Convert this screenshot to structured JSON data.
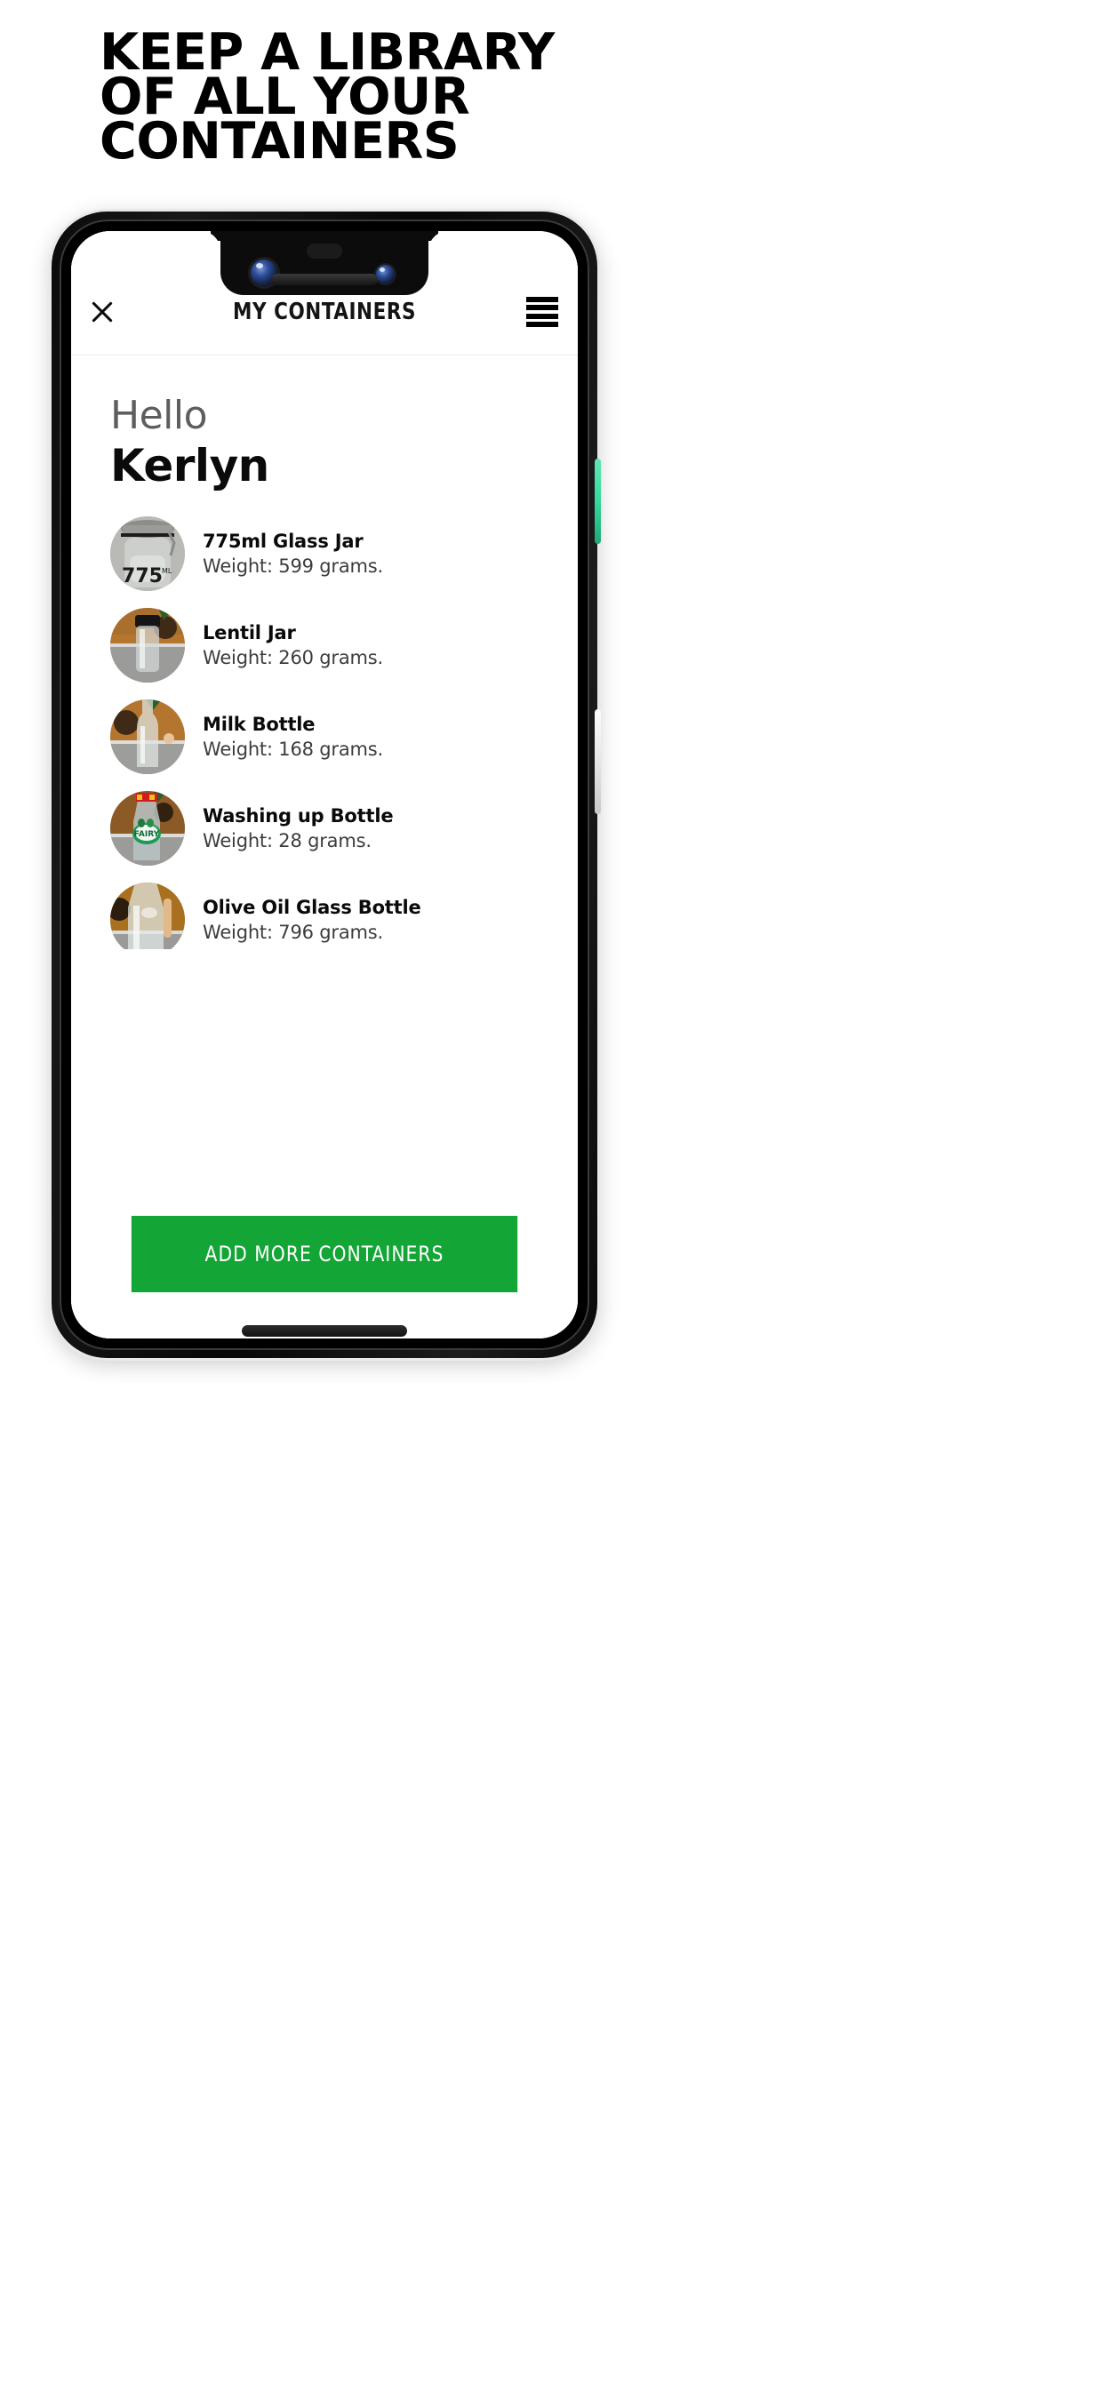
{
  "promo": {
    "headline_lines": [
      "KEEP A LIBRARY",
      "OF ALL YOUR",
      "CONTAINERS"
    ]
  },
  "device": {
    "power_button": "power-button",
    "volume_button": "volume-rocker",
    "speaker": "bottom-speaker"
  },
  "app": {
    "header": {
      "title": "MY CONTAINERS",
      "close_icon": "close-icon",
      "menu_icon": "hamburger-menu-icon"
    },
    "greeting": {
      "salutation": "Hello",
      "name": "Kerlyn"
    },
    "list": {
      "items": [
        {
          "title": "775ml Glass Jar",
          "weight": "Weight: 599 grams.",
          "grams": 599,
          "image": "glass-jar-775ml-photo"
        },
        {
          "title": "Lentil Jar",
          "weight": "Weight: 260 grams.",
          "grams": 260,
          "image": "lentil-jar-photo"
        },
        {
          "title": "Milk Bottle",
          "weight": "Weight: 168 grams.",
          "grams": 168,
          "image": "milk-bottle-photo"
        },
        {
          "title": "Washing up Bottle",
          "weight": "Weight: 28 grams.",
          "grams": 28,
          "image": "washing-up-bottle-photo"
        },
        {
          "title": "Olive Oil Glass Bottle",
          "weight": "Weight: 796 grams.",
          "grams": 796,
          "image": "olive-oil-bottle-photo"
        },
        {
          "title": "",
          "weight": "",
          "grams": null,
          "image": "partially-visible-bottle-photo"
        }
      ]
    },
    "footer": {
      "add_button_label": "ADD MORE CONTAINERS"
    }
  },
  "colors": {
    "accent_green": "#13a536",
    "power_button_green": "#35d99c",
    "text_primary": "#0a0a0a",
    "text_secondary": "#5e5e5e",
    "page_background": "#ffffff"
  }
}
